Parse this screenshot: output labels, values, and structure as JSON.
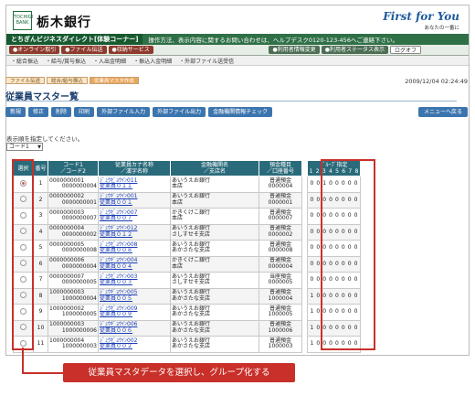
{
  "header": {
    "logo_text": "TOCHIGI BANK",
    "bank_name": "栃木銀行",
    "tagline": "First for You",
    "tagline_sub": "あなたの一番に"
  },
  "bar1": {
    "service_name": "とちぎんビジネスダイレクト[体験コーナー]",
    "notice": "操作方法、表示内容に関するお問い合わせは、ヘルプデスク0120-123-456へご連絡下さい。"
  },
  "nav_tabs": [
    {
      "label": "●オンライン取引"
    },
    {
      "label": "●ファイル伝送"
    },
    {
      "label": "●収納サービス"
    }
  ],
  "right_tabs": [
    {
      "label": "●利用者情報変更"
    },
    {
      "label": "●利用者ステータス表示"
    },
    {
      "label": "ログオフ"
    }
  ],
  "submenu": [
    "・総合振込",
    "・給与/賞与振込",
    "・入出金明細",
    "・振込入金明細",
    "・外部ファイル送受信"
  ],
  "breadcrumbs": [
    {
      "label": "ファイル伝送"
    },
    {
      "label": "総合/給与振込"
    },
    {
      "label": "従業員マスタ作成"
    }
  ],
  "datetime": "2009/12/04  02:24:49",
  "page_title": "従業員マスター覧",
  "toolbar": [
    "新規",
    "修正",
    "削除",
    "印刷",
    "外部ファイル入力",
    "外部ファイル出力",
    "金融機関情報チェック"
  ],
  "menu_back": "メニューへ戻る",
  "sort": {
    "label": "表示順を指定してください。",
    "value": "コード1"
  },
  "table": {
    "headers": {
      "select": "選択",
      "no": "番号",
      "code": "コード1\n／コード2",
      "name": "従業員カナ名称\n／漢字名称",
      "bank": "金融機関名\n／支店名",
      "account": "預金種目\n／口座番号",
      "group": "ｸﾞﾙｰﾌﾟ指定"
    },
    "group_cols": [
      "1",
      "2",
      "3",
      "4",
      "5",
      "6",
      "7",
      "8"
    ],
    "rows": [
      {
        "no": "1",
        "code1": "0000000001",
        "code2": "0000000004",
        "kana": "ｼﾞｭｳｷﾞｮｳｲﾝ011",
        "kanji": "従業員０１１",
        "bank": "あいうえお銀行",
        "branch": "本店",
        "type": "普通預金",
        "acct": "0000004",
        "flags": [
          "0",
          "0",
          "1",
          "0",
          "0",
          "0",
          "0",
          "0"
        ],
        "selected": true
      },
      {
        "no": "2",
        "code1": "0000000002",
        "code2": "0000000001",
        "kana": "ｼﾞｭｳｷﾞｮｳｲﾝ001",
        "kanji": "従業員００１",
        "bank": "あいうえお銀行",
        "branch": "本店",
        "type": "普通預金",
        "acct": "0000001",
        "flags": [
          "0",
          "0",
          "0",
          "0",
          "0",
          "0",
          "0",
          "0"
        ],
        "selected": false
      },
      {
        "no": "3",
        "code1": "0000000003",
        "code2": "0000000007",
        "kana": "ｼﾞｭｳｷﾞｮｳｲﾝ007",
        "kanji": "従業員００７",
        "bank": "かきくけこ銀行",
        "branch": "本店",
        "type": "普通預金",
        "acct": "0000007",
        "flags": [
          "0",
          "0",
          "0",
          "0",
          "0",
          "0",
          "0",
          "0"
        ],
        "selected": false
      },
      {
        "no": "4",
        "code1": "0000000004",
        "code2": "0000000002",
        "kana": "ｼﾞｭｳｷﾞｮｳｲﾝ012",
        "kanji": "従業員０１２",
        "bank": "あいうえお銀行",
        "branch": "さしすせそ支店",
        "type": "普通預金",
        "acct": "0000002",
        "flags": [
          "0",
          "0",
          "0",
          "0",
          "0",
          "0",
          "0",
          "0"
        ],
        "selected": false
      },
      {
        "no": "5",
        "code1": "0000000005",
        "code2": "0000000008",
        "kana": "ｼﾞｭｳｷﾞｮｳｲﾝ008",
        "kanji": "従業員００８",
        "bank": "あいうえお銀行",
        "branch": "あかさたな支店",
        "type": "普通預金",
        "acct": "0000008",
        "flags": [
          "0",
          "0",
          "0",
          "0",
          "0",
          "0",
          "0",
          "0"
        ],
        "selected": false
      },
      {
        "no": "6",
        "code1": "0000000006",
        "code2": "0000000004",
        "kana": "ｼﾞｭｳｷﾞｮｳｲﾝ004",
        "kanji": "従業員００４",
        "bank": "かきくけこ銀行",
        "branch": "本店",
        "type": "普通預金",
        "acct": "0000004",
        "flags": [
          "0",
          "0",
          "0",
          "0",
          "0",
          "0",
          "0",
          "0"
        ],
        "selected": false
      },
      {
        "no": "7",
        "code1": "0000000007",
        "code2": "0000000005",
        "kana": "ｼﾞｭｳｷﾞｮｳｲﾝ003",
        "kanji": "従業員００３",
        "bank": "あいうえお銀行",
        "branch": "さしすせそ支店",
        "type": "当座預金",
        "acct": "0000005",
        "flags": [
          "0",
          "0",
          "0",
          "0",
          "0",
          "0",
          "0",
          "0"
        ],
        "selected": false
      },
      {
        "no": "8",
        "code1": "1000000003",
        "code2": "1000000004",
        "kana": "ｼﾞｭｳｷﾞｮｳｲﾝ005",
        "kanji": "従業員００５",
        "bank": "あいうえお銀行",
        "branch": "あかさたな支店",
        "type": "普通預金",
        "acct": "1000004",
        "flags": [
          "1",
          "0",
          "0",
          "0",
          "0",
          "0",
          "0",
          "0"
        ],
        "selected": false
      },
      {
        "no": "9",
        "code1": "1000000002",
        "code2": "1000000005",
        "kana": "ｼﾞｭｳｷﾞｮｳｲﾝ009",
        "kanji": "従業員００９",
        "bank": "あいうえお銀行",
        "branch": "あかさたな支店",
        "type": "普通預金",
        "acct": "1000005",
        "flags": [
          "1",
          "0",
          "0",
          "0",
          "0",
          "0",
          "0",
          "0"
        ],
        "selected": false
      },
      {
        "no": "10",
        "code1": "1000000003",
        "code2": "1000000006",
        "kana": "ｼﾞｭｳｷﾞｮｳｲﾝ006",
        "kanji": "従業員００６",
        "bank": "あいうえお銀行",
        "branch": "あかさたな支店",
        "type": "普通預金",
        "acct": "1000006",
        "flags": [
          "1",
          "0",
          "0",
          "0",
          "0",
          "0",
          "0",
          "0"
        ],
        "selected": false
      },
      {
        "no": "11",
        "code1": "1000000004",
        "code2": "1000000003",
        "kana": "ｼﾞｭｳｷﾞｮｳｲﾝ002",
        "kanji": "従業員００２",
        "bank": "あいうえお銀行",
        "branch": "あかさたな支店",
        "type": "普通預金",
        "acct": "1000003",
        "flags": [
          "1",
          "0",
          "0",
          "0",
          "0",
          "0",
          "0",
          "0"
        ],
        "selected": false
      }
    ]
  },
  "callout": "従業員マスタデータを選択し、グループ化する",
  "colors": {
    "accent_red": "#c9302a",
    "header_teal": "#2a6b7b",
    "bank_green": "#2f7046",
    "button_blue": "#3c75ae"
  }
}
